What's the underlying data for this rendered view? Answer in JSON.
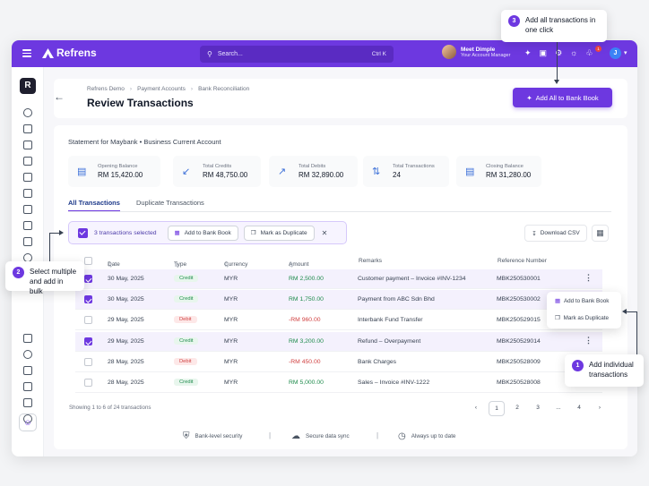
{
  "app": {
    "name": "Refrens"
  },
  "topbar": {
    "search_placeholder": "Search...",
    "search_shortcut": "Ctrl K",
    "user_name": "Meet Dimple",
    "user_role": "Your Account Manager",
    "notification_count": "1",
    "avatar_initial": "J"
  },
  "sidebar": {
    "logo_letter": "R"
  },
  "breadcrumb": [
    "Refrens Demo",
    "Payment Accounts",
    "Bank Reconciliation"
  ],
  "page_title": "Review Transactions",
  "add_all_label": "Add All to Bank Book",
  "statement_label": "Statement for Maybank • Business Current Account",
  "stats": [
    {
      "label": "Opening Balance",
      "value": "RM 15,420.00",
      "icon": "document-icon"
    },
    {
      "label": "Total Credits",
      "value": "RM 48,750.00",
      "icon": "arrow-down-left-icon"
    },
    {
      "label": "Total Debits",
      "value": "RM 32,890.00",
      "icon": "arrow-up-right-icon"
    },
    {
      "label": "Total Transactions",
      "value": "24",
      "icon": "swap-arrows-icon"
    },
    {
      "label": "Closing Balance",
      "value": "RM 31,280.00",
      "icon": "document-icon"
    }
  ],
  "tabs": [
    {
      "label": "All Transactions",
      "active": true
    },
    {
      "label": "Duplicate Transactions",
      "active": false
    }
  ],
  "bulk": {
    "selected_text": "3 transactions selected",
    "add_label": "Add to Bank Book",
    "dup_label": "Mark as Duplicate"
  },
  "toolbar": {
    "download_label": "Download CSV"
  },
  "table": {
    "headers": [
      "Date",
      "Type",
      "Currency",
      "Amount",
      "Remarks",
      "Reference Number"
    ],
    "rows": [
      {
        "date": "30 May, 2025",
        "type": "Credit",
        "currency": "MYR",
        "amount": "RM 2,500.00",
        "remarks": "Customer payment – Invoice #INV-1234",
        "ref": "MBK250530001",
        "selected": true
      },
      {
        "date": "30 May, 2025",
        "type": "Credit",
        "currency": "MYR",
        "amount": "RM 1,750.00",
        "remarks": "Payment from ABC Sdn Bhd",
        "ref": "MBK250530002",
        "selected": true
      },
      {
        "date": "29 May, 2025",
        "type": "Debit",
        "currency": "MYR",
        "amount": "-RM 960.00",
        "remarks": "Interbank Fund Transfer",
        "ref": "MBK250529015",
        "selected": false
      },
      {
        "date": "29 May, 2025",
        "type": "Credit",
        "currency": "MYR",
        "amount": "RM 3,200.00",
        "remarks": "Refund – Overpayment",
        "ref": "MBK250529014",
        "selected": true
      },
      {
        "date": "28 May, 2025",
        "type": "Debit",
        "currency": "MYR",
        "amount": "-RM 450.00",
        "remarks": "Bank Charges",
        "ref": "MBK250528009",
        "selected": false
      },
      {
        "date": "28 May, 2025",
        "type": "Credit",
        "currency": "MYR",
        "amount": "RM 5,000.00",
        "remarks": "Sales – Invoice #INV-1222",
        "ref": "MBK250528008",
        "selected": false
      }
    ]
  },
  "context_menu": {
    "add": "Add to Bank Book",
    "dup": "Mark as Duplicate"
  },
  "pagination": {
    "showing": "Showing 1 to 6 of 24 transactions",
    "pages": [
      "1",
      "2",
      "3",
      "...",
      "4"
    ]
  },
  "footer": {
    "security": "Bank-level security",
    "sync": "Secure data sync",
    "uptodate": "Always up to date"
  },
  "callouts": {
    "c3": {
      "num": "3",
      "text": "Add all transactions in one click"
    },
    "c2": {
      "num": "2",
      "text": "Select multiple and add in bulk"
    },
    "c1": {
      "num": "1",
      "text": "Add individual transactions"
    }
  },
  "colors": {
    "brand": "#6d38e0",
    "credit": "#1f8b4c",
    "debit": "#d14343"
  }
}
